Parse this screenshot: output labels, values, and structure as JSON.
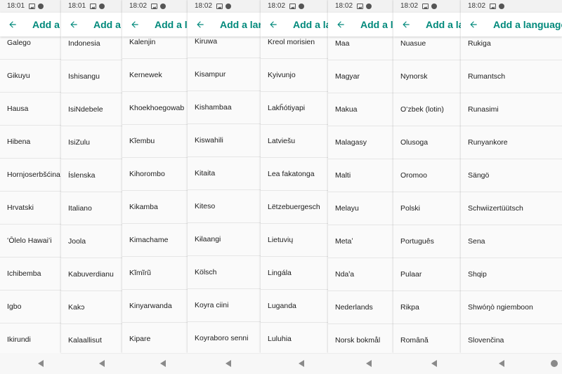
{
  "colors": {
    "accent": "#00897b",
    "text": "#202020",
    "status_bg": "#f2f2f2"
  },
  "panels": [
    {
      "time": "18:01",
      "title": "Add a l",
      "items": [
        "Galego",
        "Gikuyu",
        "Hausa",
        "Hibena",
        "Hornjoserbšćina",
        "Hrvatski",
        "ʻŌlelo Hawaiʻi",
        "Ichibemba",
        "Igbo",
        "Ikirundi"
      ]
    },
    {
      "time": "18:01",
      "title": "Add a l",
      "items": [
        "Indonesia",
        "Ishisangu",
        "IsiNdebele",
        "IsiZulu",
        "Íslenska",
        "Italiano",
        "Joola",
        "Kabuverdianu",
        "Kakɔ",
        "Kalaallisut"
      ]
    },
    {
      "time": "18:02",
      "title": "Add a la",
      "items": [
        "Kalenjin",
        "Kernewek",
        "Khoekhoegowab",
        "Kĩembu",
        "Kihorombo",
        "Kikamba",
        "Kimachame",
        "Kĩmĩrũ",
        "Kinyarwanda",
        "Kipare"
      ]
    },
    {
      "time": "18:02",
      "title": "Add a lang",
      "items": [
        "Kiruwa",
        "Kisampur",
        "Kishambaa",
        "Kiswahili",
        "Kitaita",
        "Kiteso",
        "Kɨlaangi",
        "Kölsch",
        "Koyra ciini",
        "Koyraboro senni"
      ]
    },
    {
      "time": "18:02",
      "title": "Add a lan",
      "items": [
        "Kreol morisien",
        "Kyivunjo",
        "Lakȟótiyapi",
        "Latviešu",
        "Lea fakatonga",
        "Lëtzebuergesch",
        "Lietuvių",
        "Lingála",
        "Luganda",
        "Luluhia"
      ]
    },
    {
      "time": "18:02",
      "title": "Add a la",
      "items": [
        "Maa",
        "Magyar",
        "Makua",
        "Malagasy",
        "Malti",
        "Melayu",
        "Metaʼ",
        "Ndaꞌa",
        "Nederlands",
        "Norsk bokmål"
      ]
    },
    {
      "time": "18:02",
      "title": "Add a lan",
      "items": [
        "Nuasue",
        "Nynorsk",
        "Oʻzbek (lotin)",
        "Olusoga",
        "Oromoo",
        "Polski",
        "Português",
        "Pulaar",
        "Rikpa",
        "Română"
      ]
    },
    {
      "time": "18:02",
      "title": "Add a language",
      "items": [
        "Rukiga",
        "Rumantsch",
        "Runasimi",
        "Runyankore",
        "Sängö",
        "Schwiizertüütsch",
        "Sena",
        "Shqip",
        "Shwóŋò ngiemboon",
        "Slovenčina"
      ]
    }
  ],
  "icons": {
    "back": "arrow-left-icon",
    "status_image": "image-icon",
    "status_dot": "circle-icon",
    "nav_back": "triangle-back-icon",
    "nav_home": "home-circle-icon"
  }
}
